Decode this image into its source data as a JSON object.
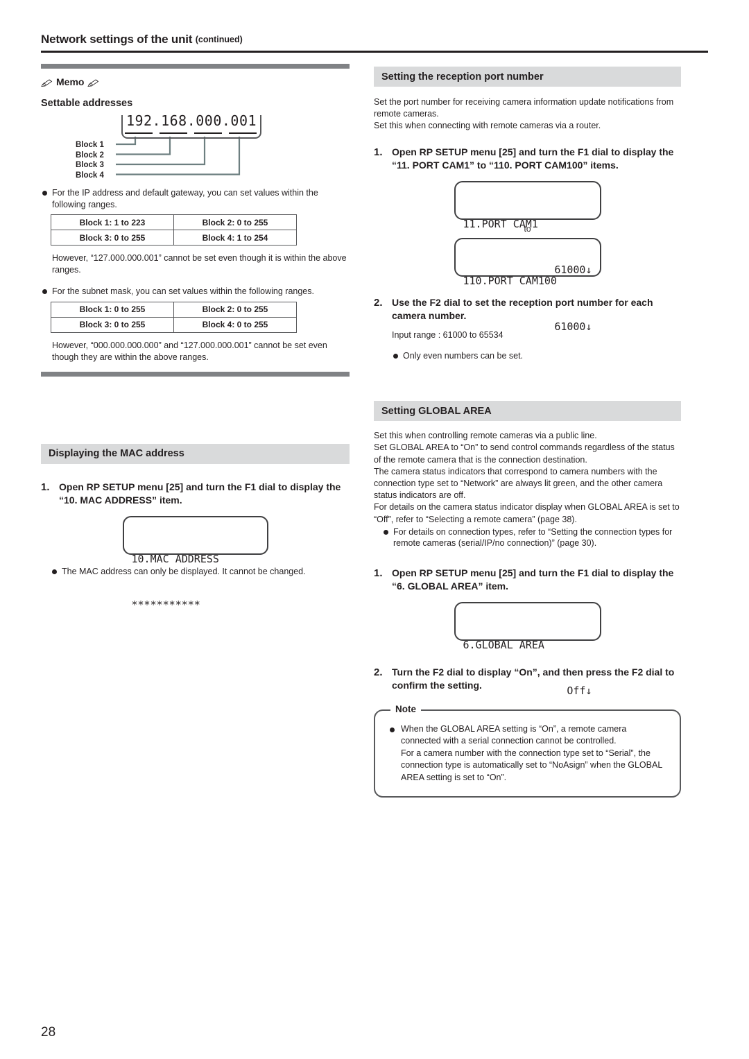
{
  "header": {
    "title": "Network settings of the unit",
    "continued": "(continued)"
  },
  "footer": {
    "page_number": "28"
  },
  "left_column": {
    "memo": {
      "label": "Memo",
      "pencil_icon": "pencil-icon",
      "sub_heading": "Settable addresses",
      "ip_diagram": {
        "address": "192.168.000.001",
        "block_labels": [
          "Block 1",
          "Block 2",
          "Block 3",
          "Block 4"
        ]
      },
      "bullet1": "For the IP address and default gateway, you can set values within the following ranges.",
      "table1": [
        [
          "Block 1: 1 to 223",
          "Block 2: 0 to 255"
        ],
        [
          "Block 3: 0 to 255",
          "Block 4: 1 to 254"
        ]
      ],
      "note1": "However, “127.000.000.001” cannot be set even though it is within the above ranges.",
      "bullet2": "For the subnet mask, you can set values within the following ranges.",
      "table2": [
        [
          "Block 1: 0 to 255",
          "Block 2: 0 to 255"
        ],
        [
          "Block 3: 0 to 255",
          "Block 4: 0 to 255"
        ]
      ],
      "note2": "However, “000.000.000.000” and “127.000.000.001” cannot be set even though they are within the above ranges."
    },
    "mac_section": {
      "heading": "Displaying the MAC address",
      "step1_num": "1.",
      "step1_text": "Open RP SETUP menu [25] and turn the F1 dial to display the “10. MAC ADDRESS” item.",
      "lcd": {
        "line1": "10.MAC ADDRESS",
        "line2": "***********"
      },
      "bullet": "The MAC address can only be displayed. It cannot be changed."
    }
  },
  "right_column": {
    "port_section": {
      "heading": "Setting the reception port number",
      "intro": "Set the port number for receiving camera information update notifications from remote cameras.\nSet this when connecting with remote cameras via a router.",
      "step1_num": "1.",
      "step1_text": "Open RP SETUP menu [25] and turn the F1 dial to display the “11. PORT CAM1” to “110. PORT CAM100” items.",
      "lcd_first": {
        "line1": "11.PORT CAM1",
        "line2": "61000↓"
      },
      "to_label": "to",
      "lcd_last": {
        "line1": "110.PORT CAM100",
        "line2": "61000↓"
      },
      "step2_num": "2.",
      "step2_text": "Use the F2 dial to set the reception port number for each camera number.",
      "input_range": "Input range  :  61000 to 65534",
      "bullet": "Only even numbers can be set."
    },
    "global_area_section": {
      "heading": "Setting GLOBAL AREA",
      "intro": "Set this when controlling remote cameras via a public line.\nSet GLOBAL AREA to “On” to send control commands regardless of the status of the remote camera that is the connection destination.\nThe camera status indicators that correspond to camera numbers with the connection type set to “Network” are always lit green, and the other camera status indicators are off.\nFor details on the camera status indicator display when GLOBAL AREA is set to “Off”, refer to “Selecting a remote camera” (page 38).",
      "bullet": "For details on connection types, refer to “Setting the connection types for remote cameras (serial/IP/no connection)” (page 30).",
      "step1_num": "1.",
      "step1_text": "Open RP SETUP menu [25] and turn the F1 dial to display the “6. GLOBAL AREA” item.",
      "lcd": {
        "line1": "6.GLOBAL AREA",
        "line2": "Off↓"
      },
      "step2_num": "2.",
      "step2_text": "Turn the F2 dial to display “On”, and then press the F2 dial to confirm the setting."
    },
    "note": {
      "label": "Note",
      "item": "When the GLOBAL AREA setting is “On”, a remote camera connected with a serial connection cannot be controlled.\nFor a camera number with the connection type set to “Serial”, the connection type is automatically set to “NoAsign” when the GLOBAL AREA setting is set to “On”."
    }
  },
  "colors": {
    "rule": "#231f20",
    "memo_bar": "#808285",
    "section_head_bg": "#d9dadb",
    "leader_line": "#6d7f80",
    "lcd_border": "#3f3f41"
  }
}
